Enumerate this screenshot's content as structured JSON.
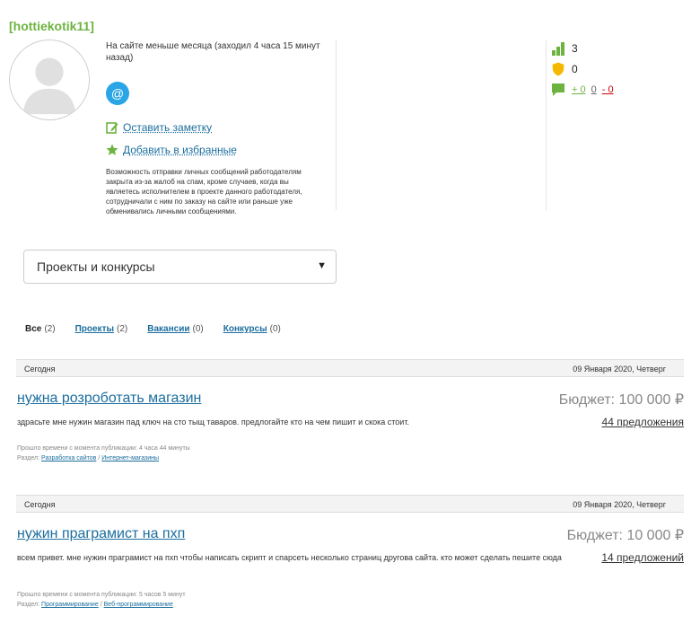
{
  "profile": {
    "username": "[hottiekotik11]",
    "status": "На сайте меньше месяца (заходил 4 часа 15 минут назад)",
    "note_label": "Оставить заметку",
    "favorite_label": "Добавить в избранные",
    "notice": "Возможность отправки личных сообщений работодателям закрыта из-за жалоб на спам, кроме случаев, когда вы являетесь исполнителем в проекте данного работодателя, сотрудничали с ним по заказу на сайте или раньше уже обменивались личными сообщениями."
  },
  "stats": {
    "rating": "3",
    "safety": "0",
    "reviews_positive": "+ 0",
    "reviews_neutral": "0",
    "reviews_negative": "- 0"
  },
  "dropdown": {
    "selected": "Проекты и конкурсы",
    "arrow": "▼"
  },
  "filters": [
    {
      "label": "Все",
      "count": "(2)"
    },
    {
      "label": "Проекты",
      "count": "(2)"
    },
    {
      "label": "Вакансии",
      "count": "(0)"
    },
    {
      "label": "Конкурсы",
      "count": "(0)"
    }
  ],
  "projects": [
    {
      "date_left": "Сегодня",
      "date_right": "09 Января 2020, Четверг",
      "title": "нужна розроботать магазин",
      "budget": "Бюджет: 100 000 ₽",
      "description": "здрасьте мне нужин магазин пад ключ на сто тыщ таваров. предлогайте кто на чем пишит и скока стоит.",
      "offers": "44 предложения",
      "elapsed": "Прошло времени с момента публикации: 4 часа 44 минуты",
      "section_label": "Раздел:",
      "section_1": "Разработка сайтов",
      "separator": "/",
      "section_2": "Интернет-магазины"
    },
    {
      "date_left": "Сегодня",
      "date_right": "09 Января 2020, Четверг",
      "title": "нужин праграмист на пхп",
      "budget": "Бюджет: 10 000 ₽",
      "description": "всем привет. мне нужин праграмист на пхп чтобы написать скрипт и спарсеть несколько страниц другова сайта. кто может сделать пешите сюда",
      "offers": "14 предложений",
      "elapsed": "Прошло времени с момента публикации: 5 часов 5 минут",
      "section_label": "Раздел:",
      "section_1": "Программирование",
      "separator": "/",
      "section_2": "Веб-программирование"
    }
  ],
  "colors": {
    "brand_green": "#6db33f",
    "link_blue": "#1b6e9e",
    "mail_blue": "#2aa6e6",
    "negative_red": "#cc0000",
    "safety_yellow": "#f5b800"
  }
}
